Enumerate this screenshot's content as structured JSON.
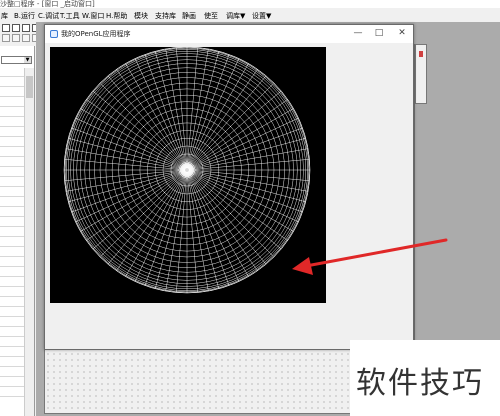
{
  "app": {
    "title_partial": "沙整□程序 - [窗口 _启动窗口]"
  },
  "menu": [
    "库",
    "B.运行",
    "C.调试",
    "T.工具",
    "W.窗口",
    "H.帮助",
    "模块",
    "支持库",
    "静画",
    "使至",
    "调库▼",
    "设置▼"
  ],
  "gl_window": {
    "title": "我的OPenGL应用程序",
    "minimize": "—",
    "maximize": "□",
    "close": "✕"
  },
  "colors": {
    "arrow": "#e02828",
    "canvas_bg": "#000000",
    "sphere_lines": "#ffffff"
  },
  "watermark": "软件技巧"
}
